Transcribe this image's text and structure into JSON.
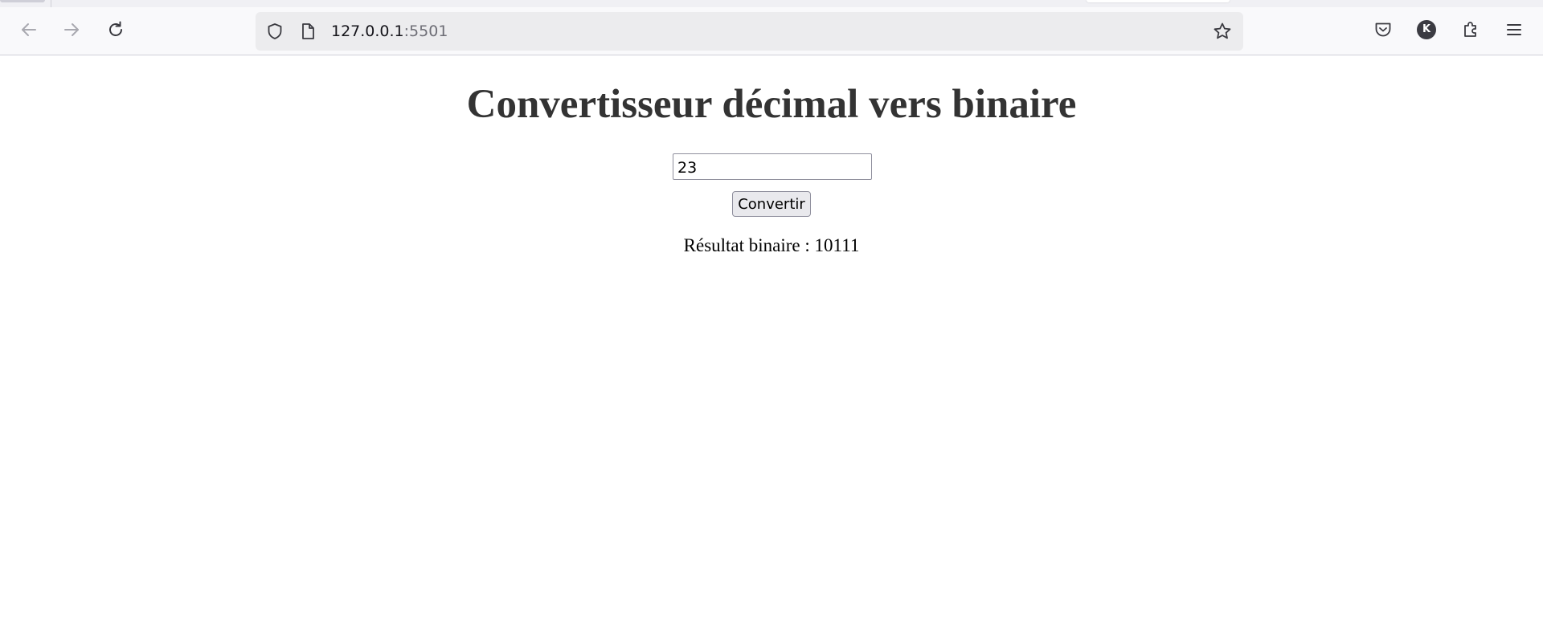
{
  "browser": {
    "url_host": "127.0.0.1",
    "url_port": ":5501",
    "profile_initial": "K",
    "icons": {
      "back": "arrow-left-icon",
      "forward": "arrow-right-icon",
      "reload": "reload-icon",
      "tracking": "shield-icon",
      "page": "document-icon",
      "bookmark": "star-icon",
      "pocket": "pocket-icon",
      "extensions": "puzzle-icon",
      "menu": "hamburger-menu-icon"
    }
  },
  "page": {
    "title": "Convertisseur décimal vers binaire",
    "input_value": "23",
    "button_label": "Convertir",
    "result_label": "Résultat binaire : ",
    "result_value": "10111"
  },
  "colors": {
    "title_text": "#333333",
    "toolbar_bg": "#f9f9fb",
    "urlbar_bg": "#ececee",
    "button_bg": "#e9e9ed"
  }
}
